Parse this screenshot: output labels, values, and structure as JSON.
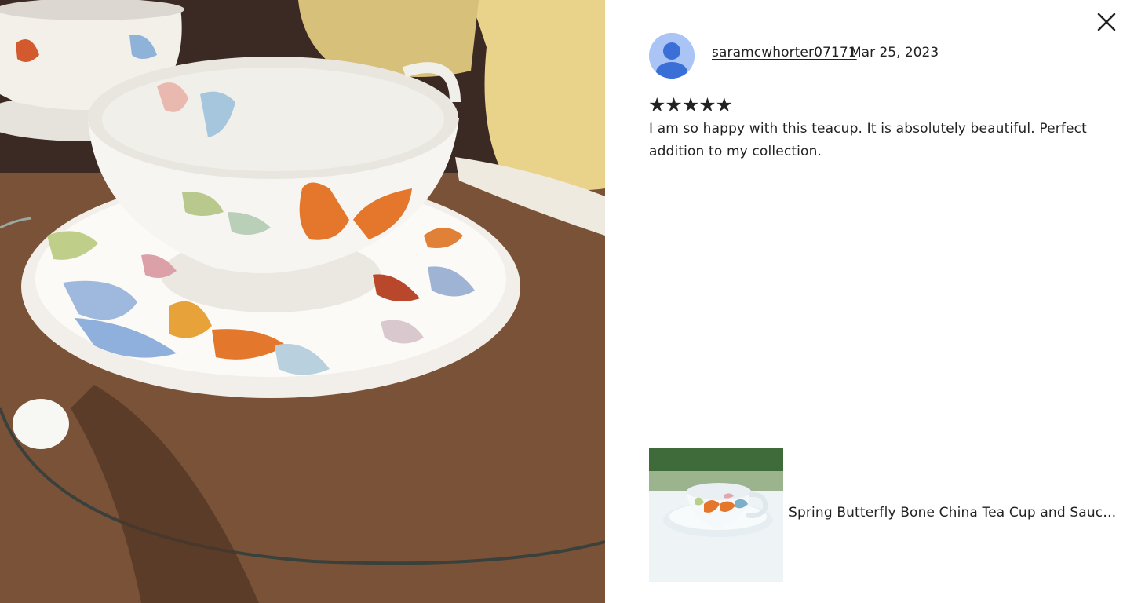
{
  "photo": {
    "icon": "review-photo"
  },
  "close": {
    "icon": "close-icon"
  },
  "review": {
    "username": "saramcwhorter07171",
    "date": "Mar 25, 2023",
    "rating": 5,
    "stars_text": "★★★★★",
    "text": "I am so happy with this teacup. It is absolutely beautiful. Perfect addition to my collection."
  },
  "product": {
    "title": "Spring Butterfly Bone China Tea Cup and Saucer S..."
  },
  "colors": {
    "text": "#222222",
    "avatar_bg": "#a9c4f5",
    "avatar_fg": "#3a6fd8",
    "background": "#ffffff"
  }
}
